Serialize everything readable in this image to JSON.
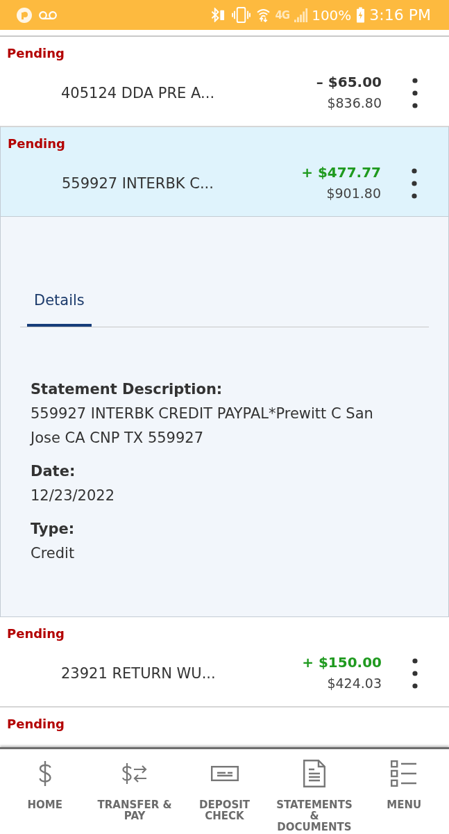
{
  "status_bar": {
    "network": "4G",
    "battery": "100%",
    "time": "3:16 PM"
  },
  "transactions": [
    {
      "status": "Pending",
      "description": "405124 DDA PRE A...",
      "amount": "– $65.00",
      "credit": false,
      "balance": "$836.80",
      "selected": false
    },
    {
      "status": "Pending",
      "description": "559927 INTERBK C...",
      "amount": "+ $477.77",
      "credit": true,
      "balance": "$901.80",
      "selected": true,
      "expanded": true,
      "details": {
        "tabs": [
          {
            "label": "Details",
            "selected": true
          }
        ],
        "fields": [
          {
            "label": "Statement Description:",
            "value": "559927 INTERBK CREDIT PAYPAL*Prewitt C San Jose CA CNP TX 559927"
          },
          {
            "label": "Date:",
            "value": "12/23/2022"
          },
          {
            "label": "Type:",
            "value": "Credit"
          }
        ]
      }
    },
    {
      "status": "Pending",
      "description": "23921 RETURN WU...",
      "amount": "+ $150.00",
      "credit": true,
      "balance": "$424.03",
      "selected": false
    },
    {
      "status": "Pending",
      "selected": false
    }
  ],
  "bottom_nav": [
    {
      "label": "HOME"
    },
    {
      "label": "TRANSFER & PAY"
    },
    {
      "label": "DEPOSIT CHECK"
    },
    {
      "label": "STATEMENTS & DOCUMENTS"
    },
    {
      "label": "MENU"
    }
  ]
}
